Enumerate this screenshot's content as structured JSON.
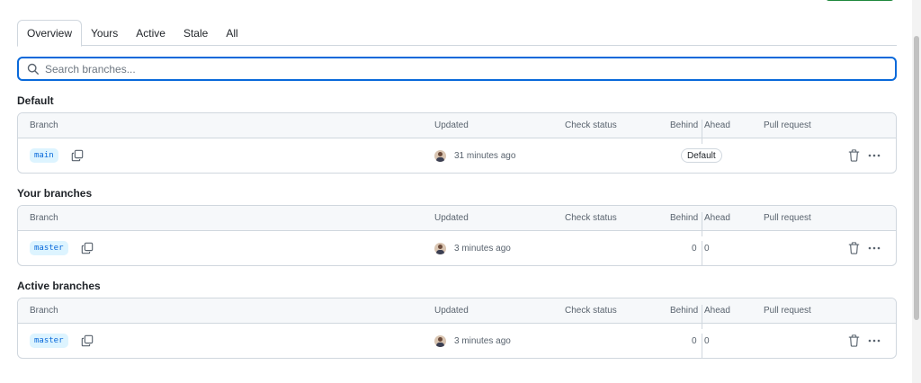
{
  "tabs": [
    {
      "label": "Overview",
      "selected": true
    },
    {
      "label": "Yours",
      "selected": false
    },
    {
      "label": "Active",
      "selected": false
    },
    {
      "label": "Stale",
      "selected": false
    },
    {
      "label": "All",
      "selected": false
    }
  ],
  "search": {
    "placeholder": "Search branches..."
  },
  "columns": {
    "branch": "Branch",
    "updated": "Updated",
    "check_status": "Check status",
    "behind": "Behind",
    "ahead": "Ahead",
    "pull_request": "Pull request"
  },
  "sections": [
    {
      "title": "Default",
      "rows": [
        {
          "branch": "main",
          "updated": "31 minutes ago",
          "badge": "Default"
        }
      ]
    },
    {
      "title": "Your branches",
      "rows": [
        {
          "branch": "master",
          "updated": "3 minutes ago",
          "behind": "0",
          "ahead": "0"
        }
      ]
    },
    {
      "title": "Active branches",
      "rows": [
        {
          "branch": "master",
          "updated": "3 minutes ago",
          "behind": "0",
          "ahead": "0"
        }
      ]
    }
  ],
  "colors": {
    "accent": "#0969da",
    "branch_label_bg": "#ddf4ff",
    "border": "#d0d7de",
    "header_bg": "#f6f8fa"
  },
  "icons": {
    "search": "search-icon",
    "copy": "copy-icon",
    "trash": "trash-icon",
    "kebab": "kebab-horizontal-icon"
  }
}
